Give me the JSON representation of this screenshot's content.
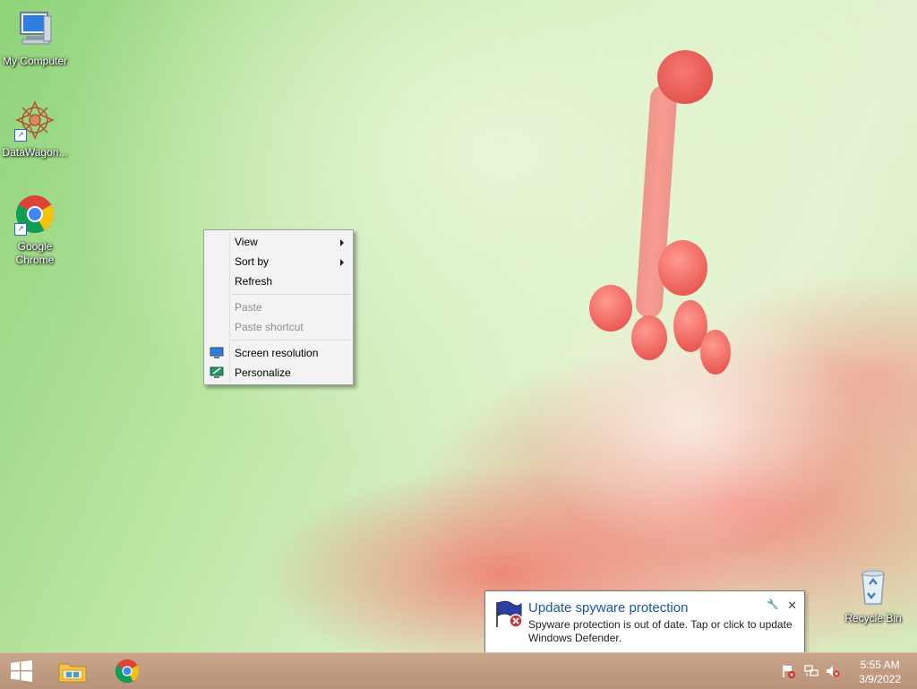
{
  "desktop": {
    "icons": [
      {
        "label": "My Computer",
        "icon": "computer-icon"
      },
      {
        "label": "DataWagon...",
        "icon": "datawagon-icon"
      },
      {
        "label": "Google Chrome",
        "icon": "chrome-icon"
      },
      {
        "label": "Recycle Bin",
        "icon": "recycle-bin-icon"
      }
    ]
  },
  "context_menu": {
    "items": [
      {
        "label": "View",
        "submenu": true,
        "enabled": true
      },
      {
        "label": "Sort by",
        "submenu": true,
        "enabled": true
      },
      {
        "label": "Refresh",
        "enabled": true
      },
      {
        "label": "Paste",
        "enabled": false
      },
      {
        "label": "Paste shortcut",
        "enabled": false
      },
      {
        "label": "Screen resolution",
        "icon": "screen-resolution-icon",
        "enabled": true
      },
      {
        "label": "Personalize",
        "icon": "personalize-icon",
        "enabled": true
      }
    ]
  },
  "notification": {
    "title": "Update spyware protection",
    "body": "Spyware protection is out of date. Tap or click to update Windows Defender.",
    "close_symbol": "✕",
    "pin_symbol": "🔧"
  },
  "taskbar": {
    "time": "5:55 AM",
    "date": "3/9/2022",
    "pinned": [
      "file-explorer-icon",
      "chrome-icon"
    ]
  },
  "colors": {
    "accent": "#1a55b0",
    "taskbar": "#c0a088"
  }
}
